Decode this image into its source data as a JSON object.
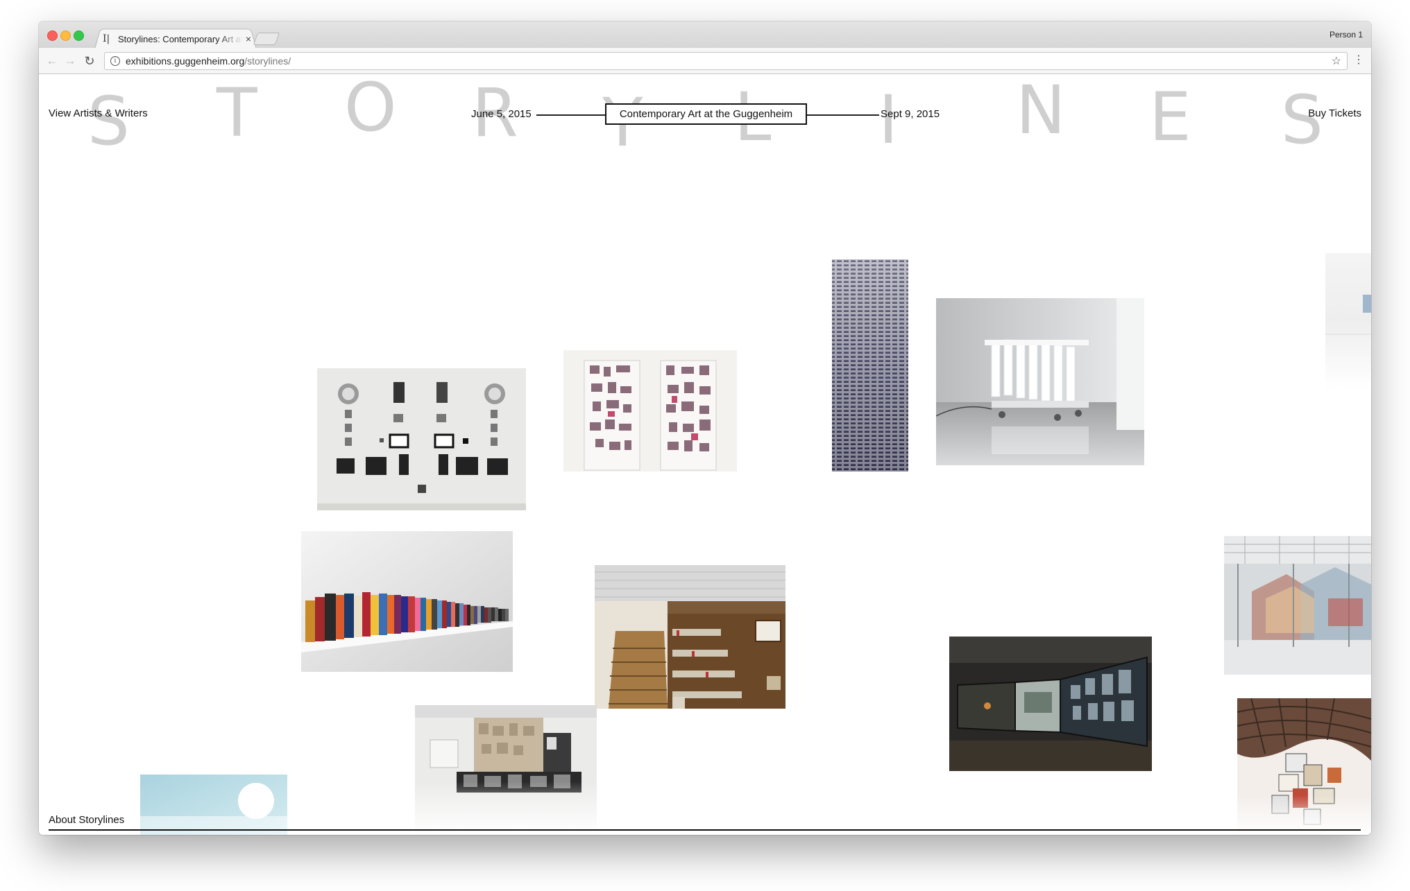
{
  "browser": {
    "tab_title": "Storylines: Contemporary Art at the Guggenheim",
    "tab_favicon": "I|",
    "tab_close": "×",
    "profile_name": "Person 1",
    "url_host": "exhibitions.guggenheim.org",
    "url_path": "/storylines/",
    "back_icon": "←",
    "forward_icon": "→",
    "reload_icon": "↻",
    "info_icon": "i",
    "star_icon": "☆",
    "menu_icon": "⋮"
  },
  "page": {
    "nav_left": "View Artists & Writers",
    "nav_right": "Buy Tickets",
    "start_date": "June 5, 2015",
    "end_date": "Sept 9, 2015",
    "exhibition_title": "Contemporary Art at the Guggenheim",
    "background_letters": [
      "S",
      "T",
      "O",
      "R",
      "Y",
      "L",
      "I",
      "N",
      "E",
      "S"
    ],
    "footer_link": "About Storylines"
  },
  "colors": {
    "page_background": "#ffffff",
    "text": "#111111",
    "background_letters": "#cfcfcf",
    "traffic_red": "#fc605b",
    "traffic_yellow": "#fdbc40",
    "traffic_green": "#34c84a"
  }
}
